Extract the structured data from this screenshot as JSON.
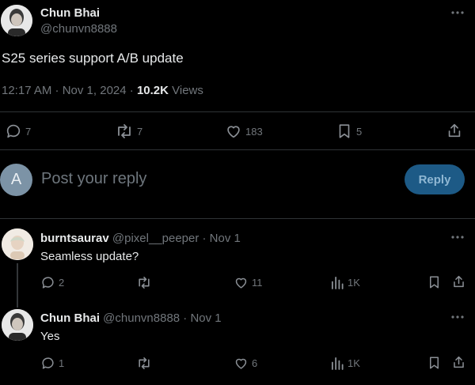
{
  "post": {
    "author_name": "Chun Bhai",
    "author_handle": "@chunvn8888",
    "text": "S25 series support A/B update",
    "time": "12:17 AM · Nov 1, 2024 · ",
    "views_count": "10.2K",
    "views_label": " Views",
    "stats": {
      "replies": "7",
      "reposts": "7",
      "likes": "183",
      "bookmarks": "5"
    }
  },
  "compose": {
    "avatar_letter": "A",
    "placeholder": "Post your reply",
    "reply_button": "Reply"
  },
  "replies": [
    {
      "author_name": "burntsaurav",
      "author_handle": "@pixel__peeper · Nov 1",
      "text": "Seamless update?",
      "stats": {
        "replies": "2",
        "reposts": "",
        "likes": "11",
        "views": "1K"
      }
    },
    {
      "author_name": "Chun Bhai",
      "author_handle": "@chunvn8888 · Nov 1",
      "text": "Yes",
      "stats": {
        "replies": "1",
        "reposts": "",
        "likes": "6",
        "views": "1K"
      }
    }
  ],
  "colors": {
    "accent": "#1d9bf0",
    "reply_button_bg": "#1d5a86",
    "muted": "#71767b"
  }
}
